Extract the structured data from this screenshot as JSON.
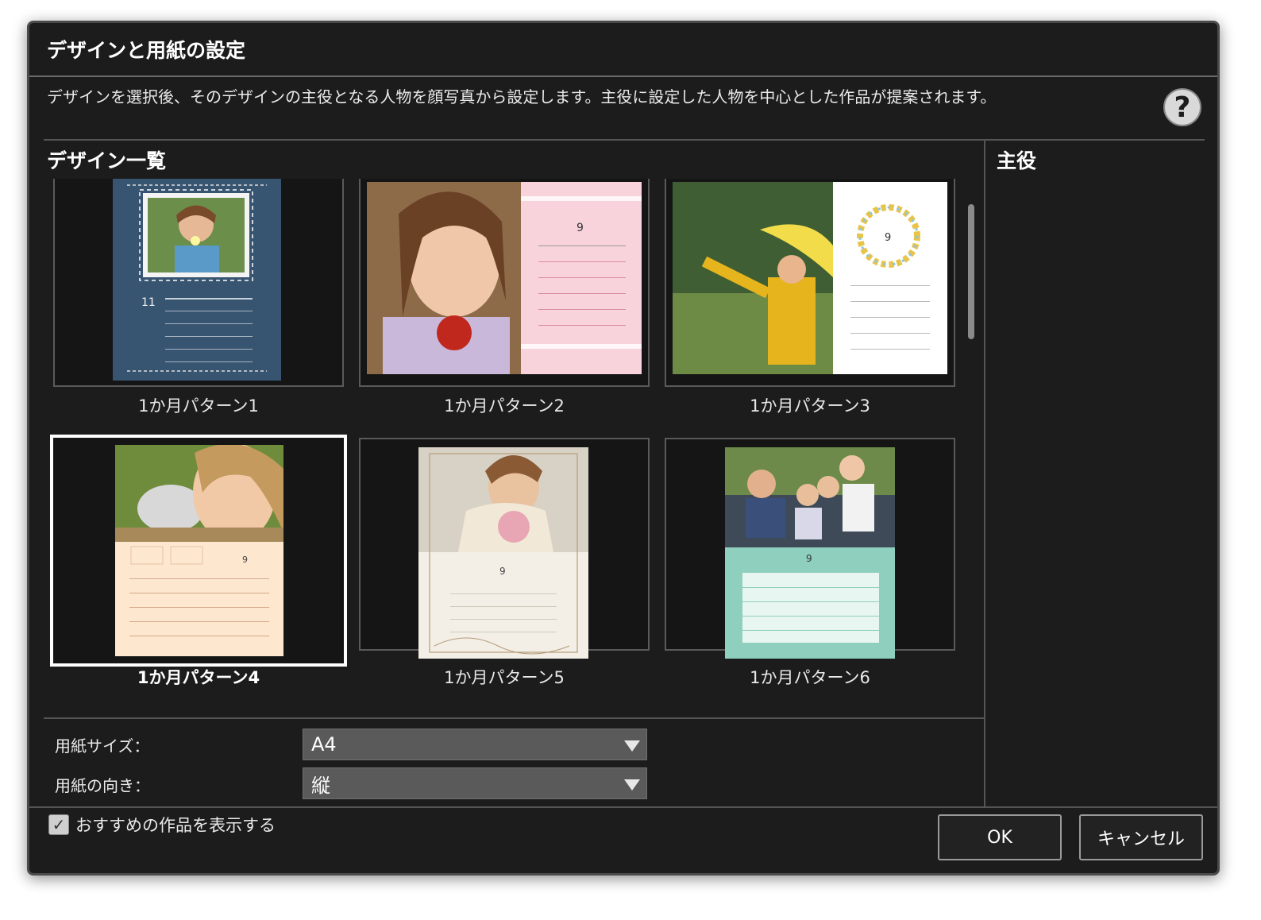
{
  "dialog": {
    "title": "デザインと用紙の設定",
    "description": "デザインを選択後、そのデザインの主役となる人物を顔写真から設定します。主役に設定した人物を中心とした作品が提案されます。",
    "help_symbol": "?"
  },
  "design_list": {
    "heading": "デザイン一覧",
    "items": [
      {
        "label": "1か月パターン1",
        "month": "11"
      },
      {
        "label": "1か月パターン2",
        "month": "9"
      },
      {
        "label": "1か月パターン3",
        "month": "9"
      },
      {
        "label": "1か月パターン4",
        "month": "9",
        "selected": true
      },
      {
        "label": "1か月パターン5",
        "month": "9"
      },
      {
        "label": "1か月パターン6",
        "month": "9"
      }
    ]
  },
  "main_character": {
    "heading": "主役"
  },
  "paper_size": {
    "label": "用紙サイズ：",
    "value": "A4"
  },
  "paper_orientation": {
    "label": "用紙の向き：",
    "value": "縦"
  },
  "recommend": {
    "label": "おすすめの作品を表示する",
    "checked": true,
    "check_mark": "✓"
  },
  "buttons": {
    "ok": "OK",
    "cancel": "キャンセル"
  },
  "colors": {
    "background": "#1c1c1c",
    "separator": "#555555",
    "select_bg": "#5a5a5a"
  }
}
